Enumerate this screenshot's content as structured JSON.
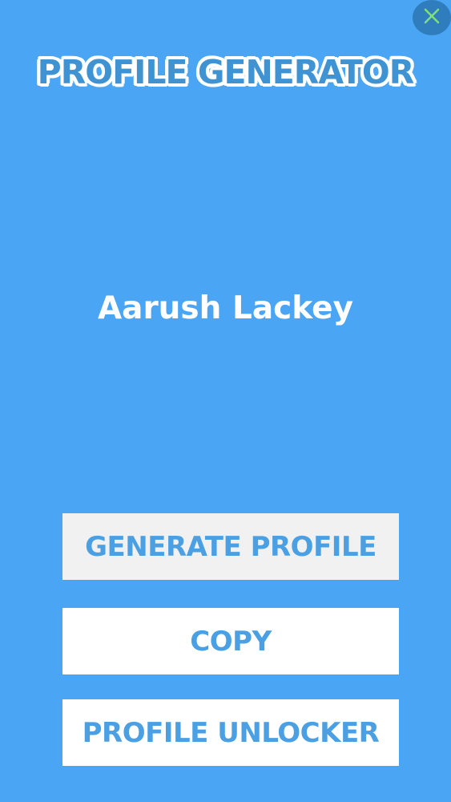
{
  "header": {
    "close_icon": "close-icon",
    "title": "PROFILE GENERATOR"
  },
  "main": {
    "generated_name": "Aarush Lackey"
  },
  "actions": {
    "generate_label": "GENERATE PROFILE",
    "copy_label": "COPY",
    "unlocker_label": "PROFILE UNLOCKER"
  },
  "colors": {
    "background": "#4aa6f4",
    "close_bg": "#2f7dbd",
    "close_x": "#7fe07a",
    "button_text": "#4aa0e3",
    "title_fill": "#3f93d2"
  }
}
